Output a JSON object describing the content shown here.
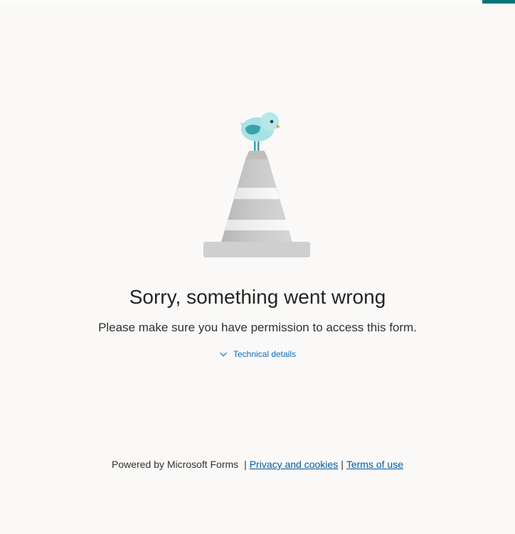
{
  "error": {
    "title": "Sorry, something went wrong",
    "message": "Please make sure you have permission to access this form.",
    "technical_details_label": "Technical details",
    "illustration_icon": "traffic-cone-with-bird-icon",
    "expand_icon": "chevron-down-icon"
  },
  "footer": {
    "powered_by": "Powered by Microsoft Forms",
    "separator": "|",
    "privacy_link": "Privacy and cookies",
    "terms_link": "Terms of use"
  },
  "colors": {
    "background": "#faf9f8",
    "accent": "#03787c",
    "link": "#005a9e",
    "bird_body": "#a8e2e6",
    "bird_wing": "#3aa2a8",
    "cone_gray": "#c8c8c8"
  }
}
